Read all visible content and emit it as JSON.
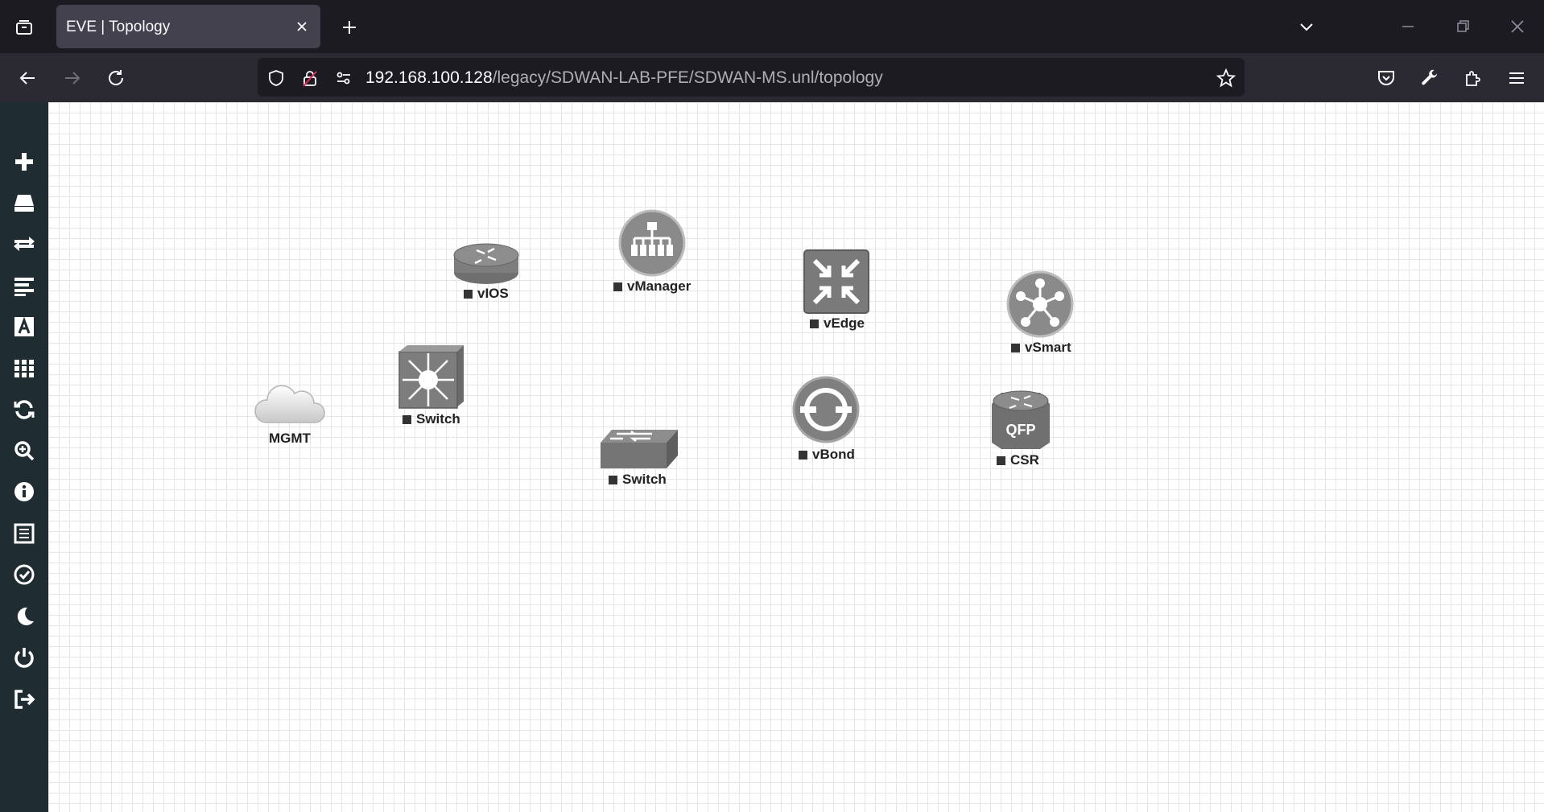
{
  "browser": {
    "tab_title": "EVE | Topology",
    "url_host": "192.168.100.128",
    "url_path": "/legacy/SDWAN-LAB-PFE/SDWAN-MS.unl/topology"
  },
  "icons": {
    "tabs": "tab-list-icon",
    "close": "close-icon",
    "new_tab": "plus-icon",
    "back": "back-arrow-icon",
    "forward": "forward-arrow-icon",
    "reload": "reload-icon",
    "shield": "shield-icon",
    "lock": "lock-insecure-icon",
    "permissions": "permissions-icon",
    "bookmark": "star-icon",
    "pocket": "pocket-icon",
    "tools": "wrench-icon",
    "extensions": "puzzle-icon",
    "menu": "hamburger-icon"
  },
  "sidebar": {
    "items": [
      {
        "icon": "plus-icon"
      },
      {
        "icon": "nodes-icon"
      },
      {
        "icon": "networks-icon"
      },
      {
        "icon": "startup-configs-icon"
      },
      {
        "icon": "text-icon"
      },
      {
        "icon": "grid-icon"
      },
      {
        "icon": "refresh-icon"
      },
      {
        "icon": "zoom-icon"
      },
      {
        "icon": "info-icon"
      },
      {
        "icon": "list-icon"
      },
      {
        "icon": "check-icon"
      },
      {
        "icon": "moon-icon"
      },
      {
        "icon": "power-icon"
      },
      {
        "icon": "logout-icon"
      }
    ]
  },
  "topology": {
    "nodes": [
      {
        "label": "MGMT",
        "type": "cloud",
        "status": false
      },
      {
        "label": "vIOS",
        "type": "router",
        "status": true
      },
      {
        "label": "vManager",
        "type": "vmanage",
        "status": true
      },
      {
        "label": "vEdge",
        "type": "vedge",
        "status": true
      },
      {
        "label": "vSmart",
        "type": "vsmart",
        "status": true
      },
      {
        "label": "Switch",
        "type": "l3-switch",
        "status": true
      },
      {
        "label": "Switch",
        "type": "l2-switch",
        "status": true
      },
      {
        "label": "vBond",
        "type": "vbond",
        "status": true
      },
      {
        "label": "CSR",
        "type": "csr",
        "status": true
      }
    ]
  },
  "colors": {
    "tabstrip": "#1c1b22",
    "navbar": "#2b2a33",
    "sidebar": "#1f2d33",
    "node_gray": "#7d7d7d",
    "canvas": "#ffffff"
  }
}
